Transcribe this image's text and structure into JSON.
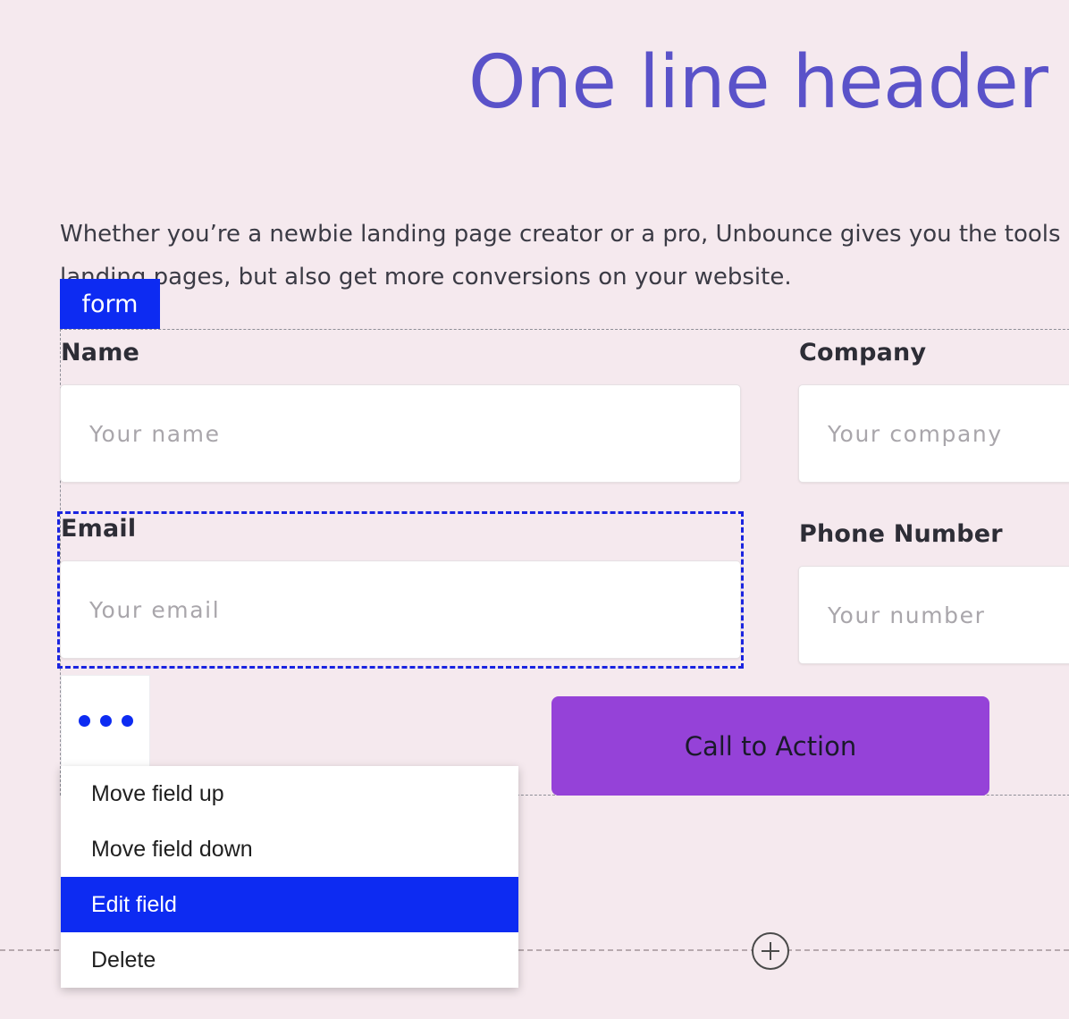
{
  "page": {
    "background_color": "#f5e9ee",
    "headline": "One line header",
    "headline_color": "#5a52c9",
    "paragraph_line1": "Whether you’re a newbie landing page creator or a pro, Unbounce gives you the tools",
    "paragraph_line2": "landing pages, but also get more conversions on your website."
  },
  "form": {
    "badge_label": "form",
    "badge_color": "#0d2bf2",
    "fields": [
      {
        "label": "Name",
        "placeholder": "Your name",
        "selected": false
      },
      {
        "label": "Company",
        "placeholder": "Your company",
        "selected": false
      },
      {
        "label": "Email",
        "placeholder": "Your email",
        "selected": true
      },
      {
        "label": "Phone Number",
        "placeholder": "Your number",
        "selected": false
      }
    ],
    "cta_label": "Call to Action",
    "cta_color": "#9542d8"
  },
  "kebab": {
    "icon": "three-dots-icon",
    "dot_color": "#0d2bf2"
  },
  "context_menu": {
    "items": [
      {
        "label": "Move field up",
        "highlighted": false
      },
      {
        "label": "Move field down",
        "highlighted": false
      },
      {
        "label": "Edit field",
        "highlighted": true
      },
      {
        "label": "Delete",
        "highlighted": false
      }
    ],
    "highlight_color": "#0d2bf2"
  },
  "section_divider": {
    "add_icon": "plus-circle-icon"
  }
}
